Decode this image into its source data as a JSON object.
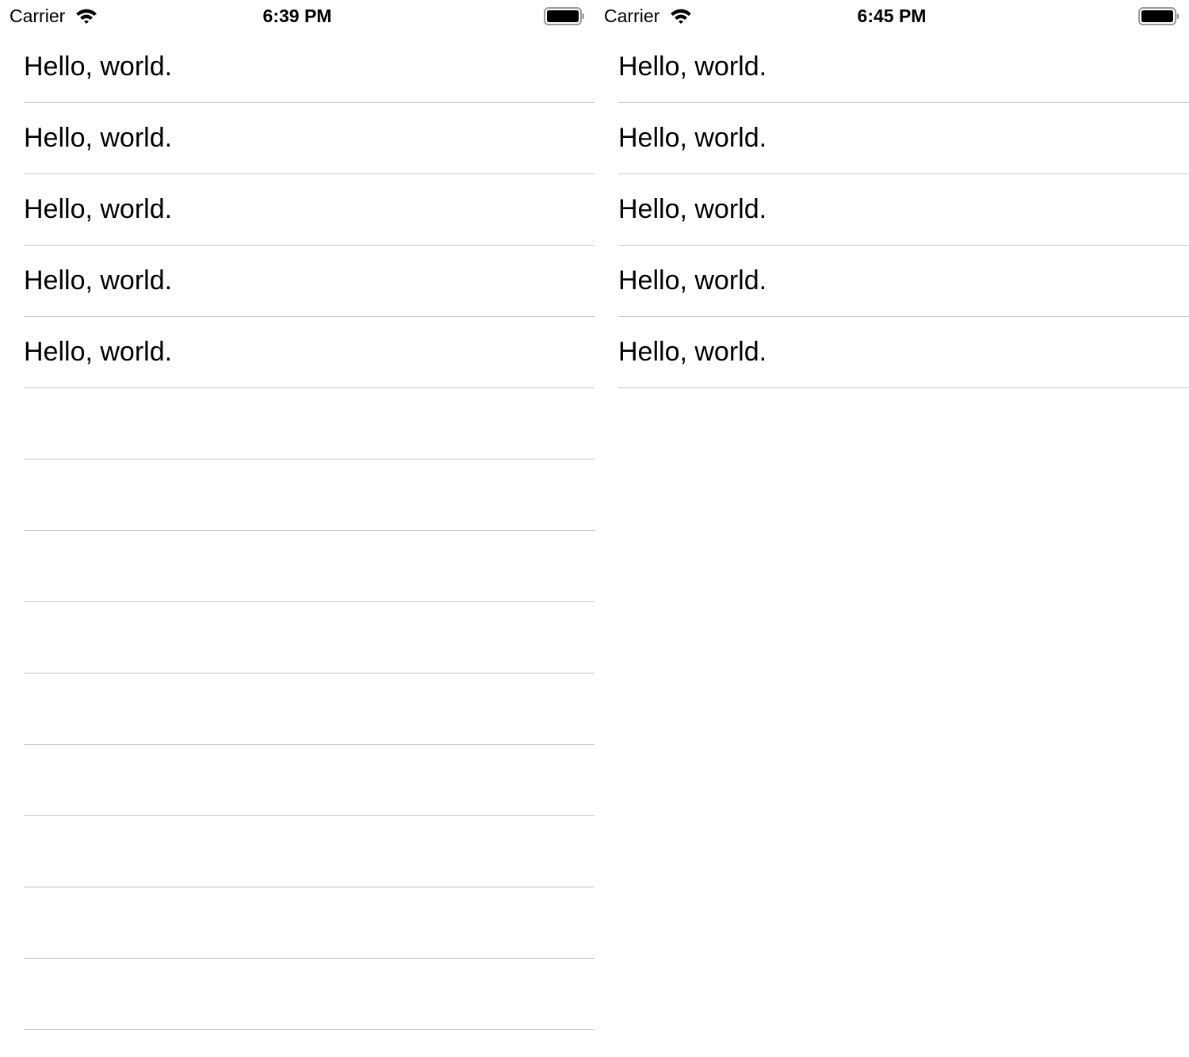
{
  "screens": [
    {
      "status_bar": {
        "carrier": "Carrier",
        "time": "6:39 PM",
        "wifi_icon": "wifi-icon",
        "battery_icon": "battery-full-icon"
      },
      "rows": [
        {
          "label": "Hello, world."
        },
        {
          "label": "Hello, world."
        },
        {
          "label": "Hello, world."
        },
        {
          "label": "Hello, world."
        },
        {
          "label": "Hello, world."
        },
        {
          "label": ""
        },
        {
          "label": ""
        },
        {
          "label": ""
        },
        {
          "label": ""
        },
        {
          "label": ""
        },
        {
          "label": ""
        },
        {
          "label": ""
        },
        {
          "label": ""
        },
        {
          "label": ""
        }
      ]
    },
    {
      "status_bar": {
        "carrier": "Carrier",
        "time": "6:45 PM",
        "wifi_icon": "wifi-icon",
        "battery_icon": "battery-full-icon"
      },
      "rows": [
        {
          "label": "Hello, world."
        },
        {
          "label": "Hello, world."
        },
        {
          "label": "Hello, world."
        },
        {
          "label": "Hello, world."
        },
        {
          "label": "Hello, world."
        }
      ]
    }
  ],
  "colors": {
    "separator": "#c8c7cc",
    "text": "#000000",
    "background": "#ffffff"
  }
}
